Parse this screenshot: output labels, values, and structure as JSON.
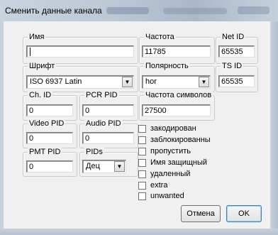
{
  "window": {
    "title": "Сменить данные канала"
  },
  "fields": {
    "name": {
      "label": "Имя",
      "value": ""
    },
    "frequency": {
      "label": "Частота",
      "value": "11785"
    },
    "net_id": {
      "label": "Net ID",
      "value": "65535"
    },
    "font": {
      "label": "Шрифт",
      "value": "ISO 6937 Latin"
    },
    "polarity": {
      "label": "Полярность",
      "value": "hor"
    },
    "ts_id": {
      "label": "TS ID",
      "value": "65535"
    },
    "ch_id": {
      "label": "Ch. ID",
      "value": "0"
    },
    "pcr_pid": {
      "label": "PCR PID",
      "value": "0"
    },
    "symbol_rate": {
      "label": "Частота символов",
      "value": "27500"
    },
    "video_pid": {
      "label": "Video PID",
      "value": "0"
    },
    "audio_pid": {
      "label": "Audio PID",
      "value": "0"
    },
    "pmt_pid": {
      "label": "PMT PID",
      "value": "0"
    },
    "pids": {
      "label": "PIDs",
      "value": "Дец"
    }
  },
  "checkboxes": [
    {
      "label": "закодирован",
      "checked": false
    },
    {
      "label": "заблокированны",
      "checked": false
    },
    {
      "label": "пропустить",
      "checked": false
    },
    {
      "label": "Имя защищный",
      "checked": false
    },
    {
      "label": "удаленный",
      "checked": false
    },
    {
      "label": "extra",
      "checked": false
    },
    {
      "label": "unwanted",
      "checked": false
    }
  ],
  "buttons": {
    "cancel": "Отмена",
    "ok": "OK"
  },
  "icons": {
    "dropdown": "chevron-down-icon"
  }
}
